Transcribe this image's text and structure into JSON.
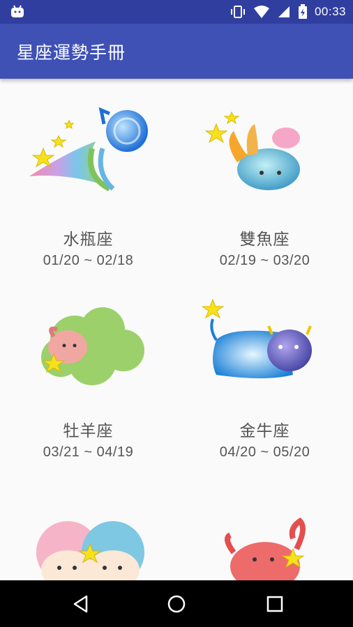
{
  "status_bar": {
    "time": "00:33",
    "icons": [
      "android-icon",
      "vibrate-icon",
      "wifi-icon",
      "signal-icon",
      "battery-icon"
    ]
  },
  "app_bar": {
    "title": "星座運勢手冊"
  },
  "signs": [
    {
      "name": "水瓶座",
      "dates": "01/20 ~ 02/18",
      "icon": "aquarius-icon"
    },
    {
      "name": "雙魚座",
      "dates": "02/19 ~ 03/20",
      "icon": "pisces-icon"
    },
    {
      "name": "牡羊座",
      "dates": "03/21 ~ 04/19",
      "icon": "aries-icon"
    },
    {
      "name": "金牛座",
      "dates": "04/20 ~ 05/20",
      "icon": "taurus-icon"
    },
    {
      "name": "",
      "dates": "",
      "icon": "gemini-icon"
    },
    {
      "name": "",
      "dates": "",
      "icon": "cancer-icon"
    }
  ],
  "nav_bar": {
    "buttons": [
      "back-icon",
      "home-icon",
      "recents-icon"
    ]
  },
  "colors": {
    "status_bar": "#303f9f",
    "app_bar": "#3f51b5",
    "background": "#fafafa",
    "nav_bar": "#000000"
  }
}
